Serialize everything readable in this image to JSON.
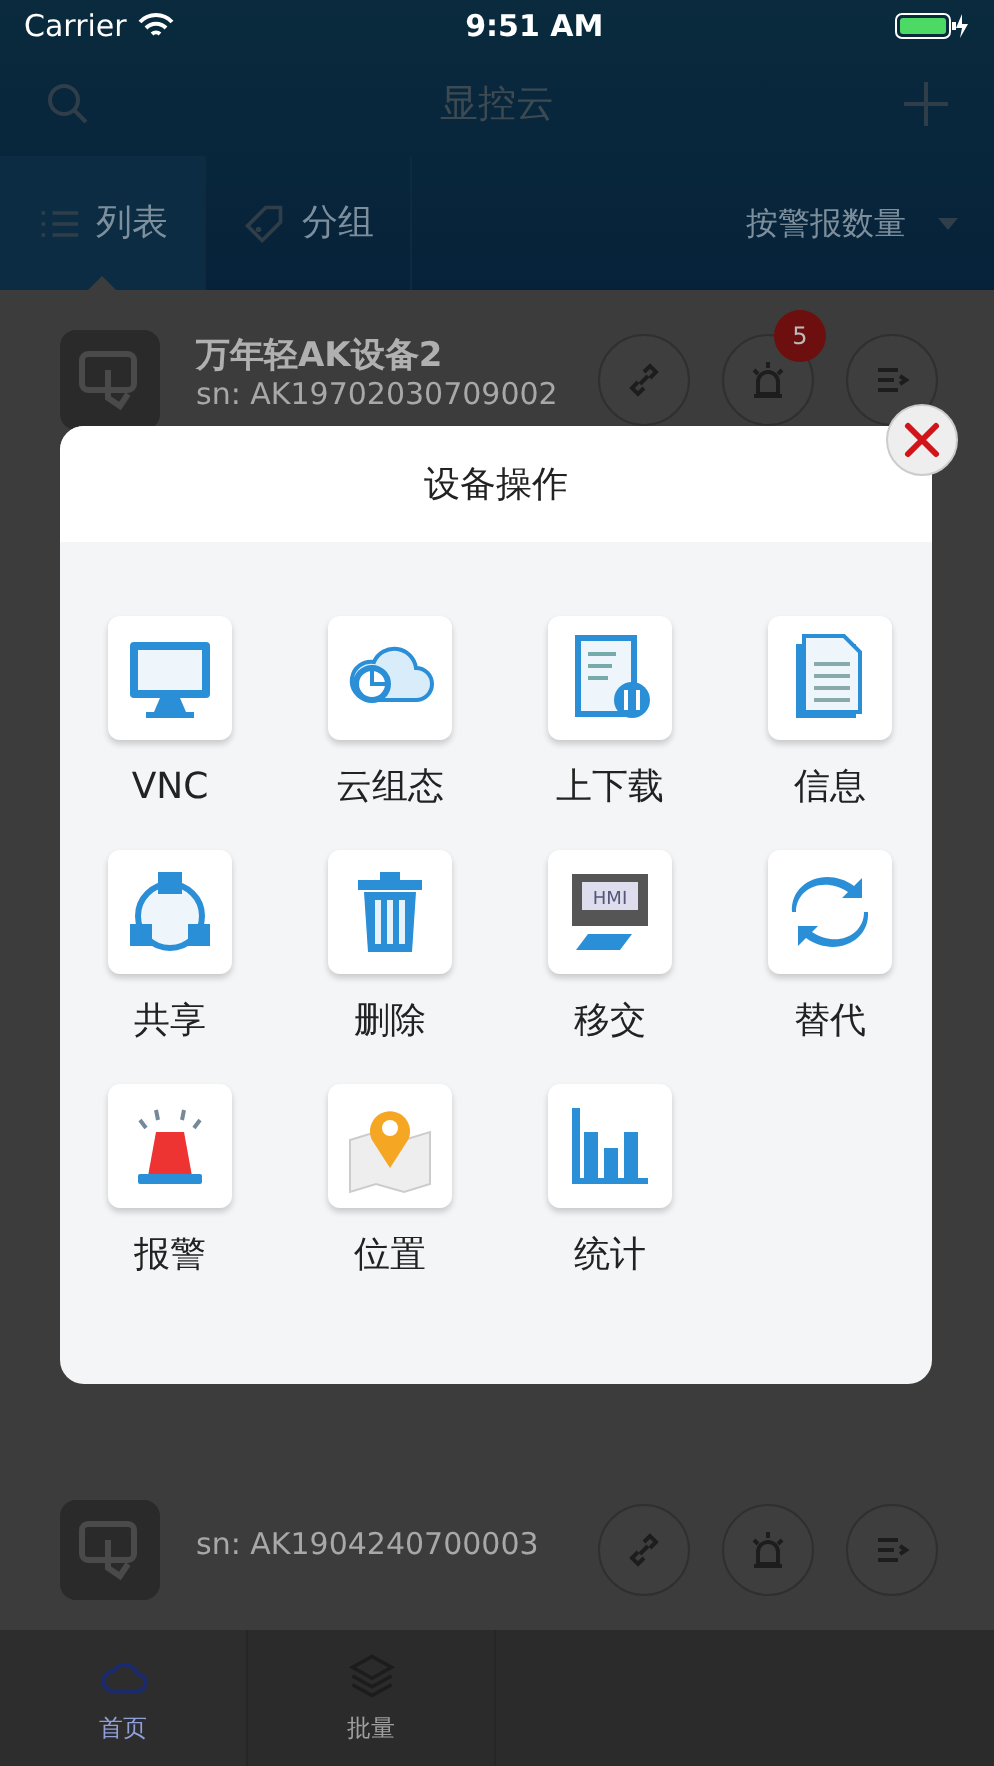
{
  "status_bar": {
    "carrier": "Carrier",
    "time": "9:51 AM"
  },
  "nav": {
    "title": "显控云"
  },
  "sub_tabs": [
    {
      "label": "列表",
      "selected": true
    },
    {
      "label": "分组",
      "selected": false
    }
  ],
  "sort": {
    "label": "按警报数量"
  },
  "devices": [
    {
      "title": "万年轻AK设备2",
      "sn": "sn: AK19702030709002",
      "alarm_badge": "5"
    },
    {
      "sn": "sn: AK1904240700003"
    }
  ],
  "dialog": {
    "title": "设备操作",
    "actions": [
      {
        "label": "VNC"
      },
      {
        "label": "云组态"
      },
      {
        "label": "上下载"
      },
      {
        "label": "信息"
      },
      {
        "label": "共享"
      },
      {
        "label": "删除"
      },
      {
        "label": "移交",
        "icon_text": "HMI"
      },
      {
        "label": "替代"
      },
      {
        "label": "报警"
      },
      {
        "label": "位置"
      },
      {
        "label": "统计"
      }
    ]
  },
  "tab_bar": [
    {
      "label": "首页",
      "selected": true
    },
    {
      "label": "批量",
      "selected": false
    }
  ]
}
